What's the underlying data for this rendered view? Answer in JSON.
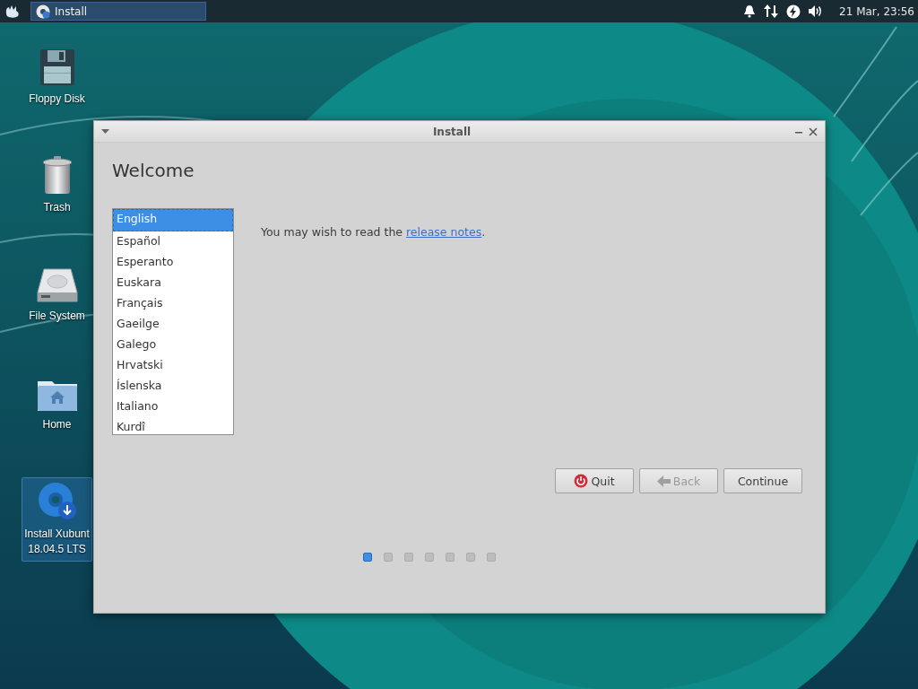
{
  "panel": {
    "task": {
      "label": "Install",
      "selected": true
    },
    "clock": "21 Mar, 23:56"
  },
  "desktop_icons": [
    {
      "kind": "floppy",
      "label": "Floppy Disk",
      "selected": false
    },
    {
      "kind": "trash",
      "label": "Trash",
      "selected": false
    },
    {
      "kind": "drive",
      "label": "File System",
      "selected": false
    },
    {
      "kind": "home",
      "label": "Home",
      "selected": false
    },
    {
      "kind": "installer",
      "label": "Install Xubunt",
      "label_2": "18.04.5 LTS",
      "selected": true
    }
  ],
  "window": {
    "title": "Install",
    "heading": "Welcome",
    "languages": [
      {
        "label": "English",
        "selected": true
      },
      {
        "label": "Español",
        "selected": false
      },
      {
        "label": "Esperanto",
        "selected": false
      },
      {
        "label": "Euskara",
        "selected": false
      },
      {
        "label": "Français",
        "selected": false
      },
      {
        "label": "Gaeilge",
        "selected": false
      },
      {
        "label": "Galego",
        "selected": false
      },
      {
        "label": "Hrvatski",
        "selected": false
      },
      {
        "label": "Íslenska",
        "selected": false
      },
      {
        "label": "Italiano",
        "selected": false
      },
      {
        "label": "Kurdî",
        "selected": false
      }
    ],
    "note": "You may wish to read the ",
    "note_link": "release notes",
    "note_end": ".",
    "buttons": [
      {
        "kind": "quit",
        "label": "Quit",
        "disabled": false
      },
      {
        "kind": "back",
        "label": "Back",
        "disabled": true
      },
      {
        "kind": "continue",
        "label": "Continue",
        "disabled": false
      }
    ],
    "steps": [
      {
        "selected": true
      },
      {
        "selected": false
      },
      {
        "selected": false
      },
      {
        "selected": false
      },
      {
        "selected": false
      },
      {
        "selected": false
      },
      {
        "selected": false
      }
    ]
  }
}
